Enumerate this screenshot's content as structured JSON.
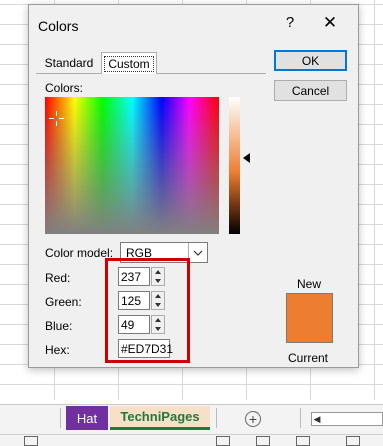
{
  "dialog": {
    "title": "Colors",
    "help": "?",
    "close": "✕",
    "ok_label": "OK",
    "cancel_label": "Cancel",
    "tabs": [
      {
        "label": "Standard",
        "selected": false
      },
      {
        "label": "Custom",
        "selected": true
      }
    ],
    "colors_label": "Colors:",
    "color_model": {
      "label": "Color model:",
      "value": "RGB"
    },
    "fields": {
      "red": {
        "label": "Red:",
        "value": "237"
      },
      "green": {
        "label": "Green:",
        "value": "125"
      },
      "blue": {
        "label": "Blue:",
        "value": "49"
      },
      "hex": {
        "label": "Hex:",
        "value": "#ED7D31"
      }
    },
    "preview": {
      "new_label": "New",
      "current_label": "Current",
      "color": "#ED7D31"
    }
  },
  "sheet_tabs": [
    {
      "label": "Hat",
      "color": "#7030A0"
    },
    {
      "label": "TechniPages",
      "color": "#1F7A3A",
      "active": true
    }
  ],
  "add_sheet": "+",
  "highlight_color": "#D00000"
}
